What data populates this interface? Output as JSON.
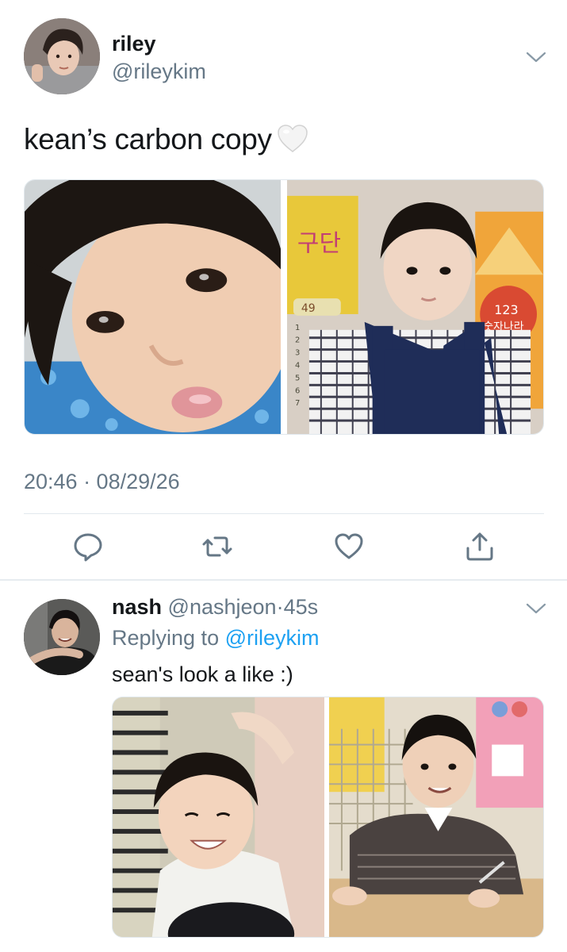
{
  "main_tweet": {
    "author_name": "riley",
    "author_handle": "@rileykim",
    "text": "kean’s carbon copy",
    "emoji": "white-heart",
    "timestamp": "20:46 · 08/29/26",
    "actions": [
      "reply-icon",
      "retweet-icon",
      "like-icon",
      "share-icon"
    ]
  },
  "reply_tweet": {
    "author_name": "nash",
    "author_handle": "@nashjeon",
    "separator": "·",
    "time": "45s",
    "replying_prefix": "Replying to",
    "replying_to": "@rileykim",
    "text": "sean's look a like :)"
  },
  "photo_text": {
    "sign_top": "구단",
    "sign_num": "49",
    "badge_num": "123",
    "badge_text": "숫자나라",
    "list_nums": [
      "1",
      "2",
      "3",
      "4",
      "5",
      "6",
      "7"
    ]
  },
  "colors": {
    "text": "#14171a",
    "secondary": "#657786",
    "link": "#1da1f2",
    "divider": "#e1e8ed"
  }
}
